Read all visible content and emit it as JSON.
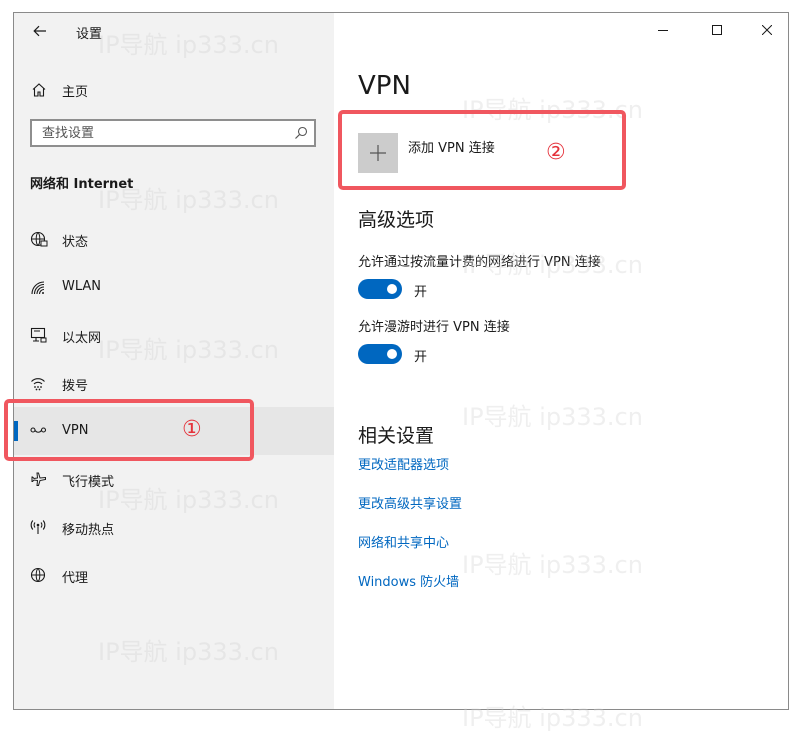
{
  "window": {
    "title": "设置"
  },
  "sidebar": {
    "home_label": "主页",
    "search_placeholder": "查找设置",
    "section_label": "网络和 Internet",
    "items": [
      {
        "label": "状态",
        "icon": "globe-status-icon"
      },
      {
        "label": "WLAN",
        "icon": "wifi-icon"
      },
      {
        "label": "以太网",
        "icon": "ethernet-icon"
      },
      {
        "label": "拨号",
        "icon": "dialup-icon"
      },
      {
        "label": "VPN",
        "icon": "vpn-icon",
        "selected": true
      },
      {
        "label": "飞行模式",
        "icon": "airplane-icon"
      },
      {
        "label": "移动热点",
        "icon": "hotspot-icon"
      },
      {
        "label": "代理",
        "icon": "globe-icon"
      }
    ]
  },
  "main": {
    "title": "VPN",
    "add_vpn_label": "添加 VPN 连接",
    "advanced": {
      "title": "高级选项",
      "options": [
        {
          "text": "允许通过按流量计费的网络进行 VPN 连接",
          "state": "开",
          "on": true
        },
        {
          "text": "允许漫游时进行 VPN 连接",
          "state": "开",
          "on": true
        }
      ]
    },
    "related": {
      "title": "相关设置",
      "links": [
        "更改适配器选项",
        "更改高级共享设置",
        "网络和共享中心",
        "Windows 防火墙"
      ]
    }
  },
  "annotations": {
    "one": "①",
    "two": "②"
  },
  "watermark": "IP导航 ip333.cn",
  "colors": {
    "accent": "#0067c0",
    "sidebar_bg": "#f2f2f2",
    "selected_bg": "#e6e6e6",
    "annotation": "#f0575f"
  }
}
